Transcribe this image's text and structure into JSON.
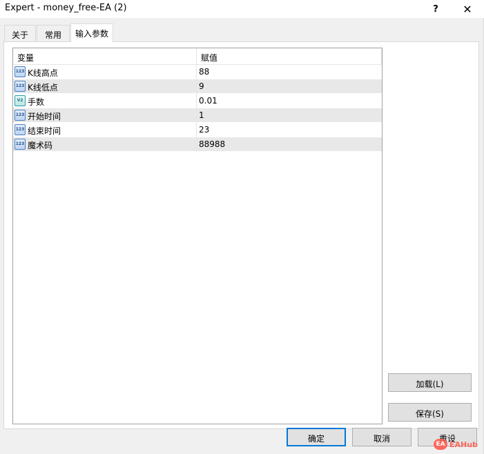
{
  "window": {
    "title": "Expert - money_free-EA (2)",
    "help_glyph": "?",
    "close_glyph": "✕"
  },
  "tabs": [
    {
      "label": "关于",
      "active": false
    },
    {
      "label": "常用",
      "active": false
    },
    {
      "label": "输入参数",
      "active": true
    }
  ],
  "grid": {
    "headers": {
      "variable": "变量",
      "value": "赋值"
    },
    "rows": [
      {
        "icon": "int-123-icon",
        "icon_text": "123",
        "name": "K线高点",
        "value": "88"
      },
      {
        "icon": "int-123-icon",
        "icon_text": "123",
        "name": "K线低点",
        "value": "9"
      },
      {
        "icon": "double-v2-icon",
        "icon_text": "V2",
        "name": "手数",
        "value": "0.01"
      },
      {
        "icon": "int-123-icon",
        "icon_text": "123",
        "name": "开始时间",
        "value": "1"
      },
      {
        "icon": "int-123-icon",
        "icon_text": "123",
        "name": "结束时间",
        "value": "23"
      },
      {
        "icon": "int-123-icon",
        "icon_text": "123",
        "name": "魔术码",
        "value": "88988"
      }
    ]
  },
  "buttons": {
    "load": "加载(L)",
    "save": "保存(S)",
    "ok": "确定",
    "cancel": "取消",
    "reset": "重设"
  },
  "watermark": {
    "logo_text": "EA",
    "text": "EAHub"
  },
  "colors": {
    "alt_row": "#e8e8e8",
    "default_button_border": "#0078d7",
    "watermark": "#ff5b4f"
  }
}
